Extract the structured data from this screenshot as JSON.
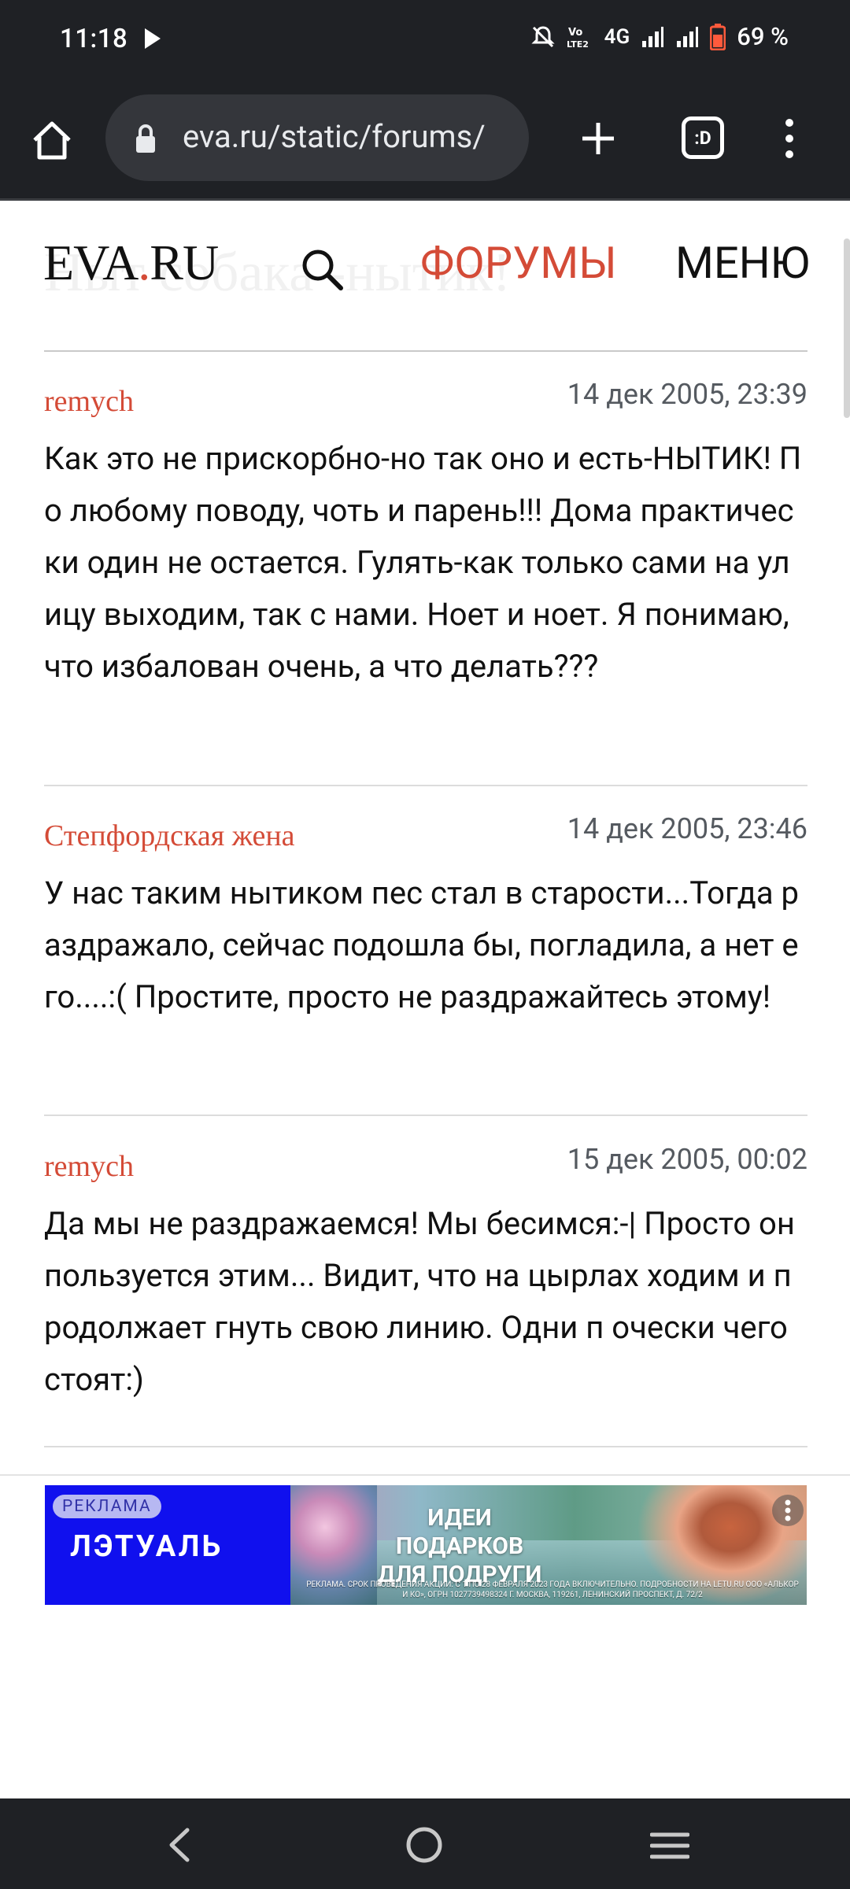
{
  "status_bar": {
    "time": "11:18",
    "network": "4G",
    "battery": "69 %"
  },
  "browser": {
    "url": "eva.ru/static/forums/",
    "tabs_label": ":D"
  },
  "site": {
    "logo_prefix": "EVA",
    "logo_dot": ".",
    "logo_suffix": "RU",
    "ghost_title": "Ныт собака -нытик!",
    "nav_forums": "ФОРУМЫ",
    "nav_menu": "МЕНЮ"
  },
  "posts": [
    {
      "author": "remych",
      "date": "14 дек 2005, 23:39",
      "text": "Как это не прискорбно-но так оно и есть-НЫТИК! По любому поводу, чоть и парень!!! Дома практически один не остается. Гулять-как только сами на улицу выходим, так с нами. Ноет и ноет. Я понимаю, что избалован очень, а что делать???"
    },
    {
      "author": "Степфордская жена",
      "date": "14 дек 2005, 23:46",
      "text": "У нас таким нытиком пес стал в старости...Тогда раздражало, сейчас подошла бы, погладила, а нет его....:( Простите, просто не раздражайтесь этому!"
    },
    {
      "author": "remych",
      "date": "15 дек 2005, 00:02",
      "text": "Да мы не раздражаемся! Мы бесимся:-| Просто он пользуется этим... Видит, что на цырлах ходим и продолжает гнуть свою линию. Одни п очески чего стоят:)"
    }
  ],
  "ad": {
    "badge": "РЕКЛАМА",
    "brand": "ЛЭТУАЛЬ",
    "headline": "ИДЕИ ПОДАРКОВ ДЛЯ ПОДРУГИ",
    "fine_print": "РЕКЛАМА. СРОК ПРОВЕДЕНИЯ АКЦИИ: С 1 ПО 28 ФЕВРАЛЯ 2023 ГОДА ВКЛЮЧИТЕЛЬНО. ПОДРОБНОСТИ НА LETU.RU ООО «АЛЬКОР И КО», ОГРН 1027739498324 Г. МОСКВА, 119261, ЛЕНИНСКИЙ ПРОСПЕКТ, Д. 72/2"
  },
  "colors": {
    "accent": "#d44b37",
    "chrome_bg": "#1f2125",
    "ad_blue": "#1010ee"
  }
}
